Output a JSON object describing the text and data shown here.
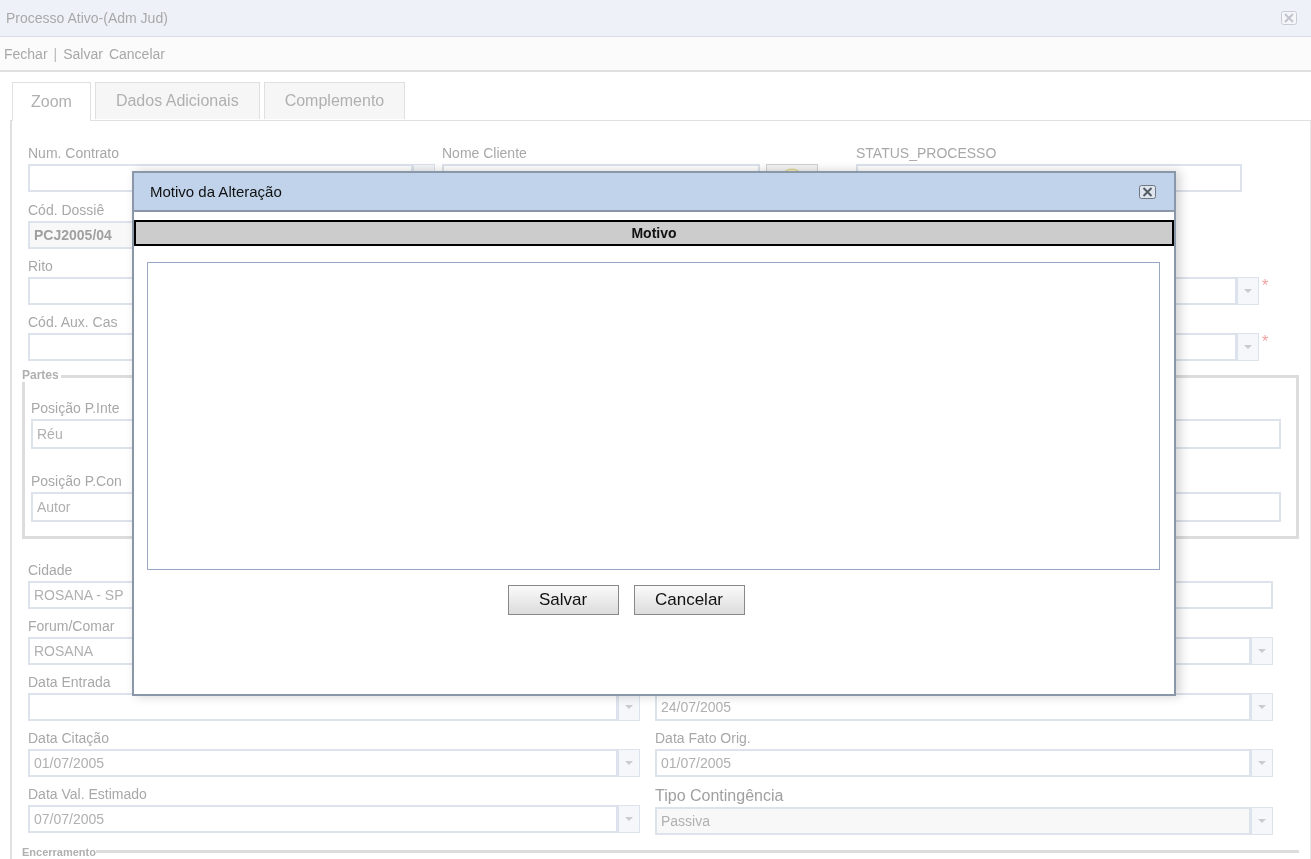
{
  "window": {
    "title": "Processo Ativo-(Adm Jud)"
  },
  "toolbar": [
    {
      "kind": "link",
      "label": "Fechar"
    },
    {
      "kind": "separator",
      "label": "|"
    },
    {
      "kind": "link",
      "label": "Salvar"
    },
    {
      "kind": "link",
      "label": "Cancelar"
    }
  ],
  "tabs": [
    {
      "label": "Zoom",
      "selected": true
    },
    {
      "label": "Dados Adicionais",
      "selected": false
    },
    {
      "label": "Complemento",
      "selected": false
    }
  ],
  "header_row": [
    {
      "label": "Num. Contrato",
      "kind": "lookup"
    },
    {
      "label": "Nome Cliente",
      "kind": "lookup-icon"
    },
    {
      "label": "STATUS_PROCESSO",
      "kind": "text"
    }
  ],
  "upper_rows": [
    {
      "left": {
        "label": "Cód. Dossiê",
        "value": "PCJ2005/04",
        "kind": "display"
      },
      "right": {
        "kind": "none"
      }
    },
    {
      "left": {
        "label": "Rito",
        "kind": "text"
      },
      "right": {
        "kind": "select",
        "marker": "*"
      }
    },
    {
      "left": {
        "label": "Cód. Aux. Cas",
        "kind": "text"
      },
      "right": {
        "kind": "select",
        "marker": "*"
      }
    }
  ],
  "partes": {
    "legend": "Partes",
    "fields": [
      {
        "label": "Posição P.Inte",
        "value": "Réu"
      },
      {
        "label": "Posição P.Con",
        "value": "Autor"
      }
    ]
  },
  "lower_rows": [
    {
      "left": {
        "label": "Cidade",
        "value": "ROSANA - SP",
        "kind": "text"
      },
      "right": {
        "kind": "text"
      }
    },
    {
      "left": {
        "label": "Forum/Comar",
        "value": "ROSANA",
        "kind": "text"
      },
      "right": {
        "kind": "select"
      }
    },
    {
      "left": {
        "label": "Data Entrada",
        "kind": "select"
      },
      "right": {
        "value": "24/07/2005",
        "kind": "select"
      }
    },
    {
      "left": {
        "label": "Data Citação",
        "value": "01/07/2005",
        "kind": "select"
      },
      "right": {
        "label": "Data Fato Orig.",
        "value": "01/07/2005",
        "kind": "select"
      }
    },
    {
      "left": {
        "label": "Data Val. Estimado",
        "value": "07/07/2005",
        "kind": "select"
      },
      "right": {
        "label": "Tipo Contingência",
        "value": "Passiva",
        "kind": "select-large"
      }
    }
  ],
  "encerramento": {
    "legend": "Encerramento"
  },
  "dialog": {
    "title": "Motivo da Alteração",
    "column_header": "Motivo",
    "buttons": [
      "Salvar",
      "Cancelar"
    ]
  }
}
